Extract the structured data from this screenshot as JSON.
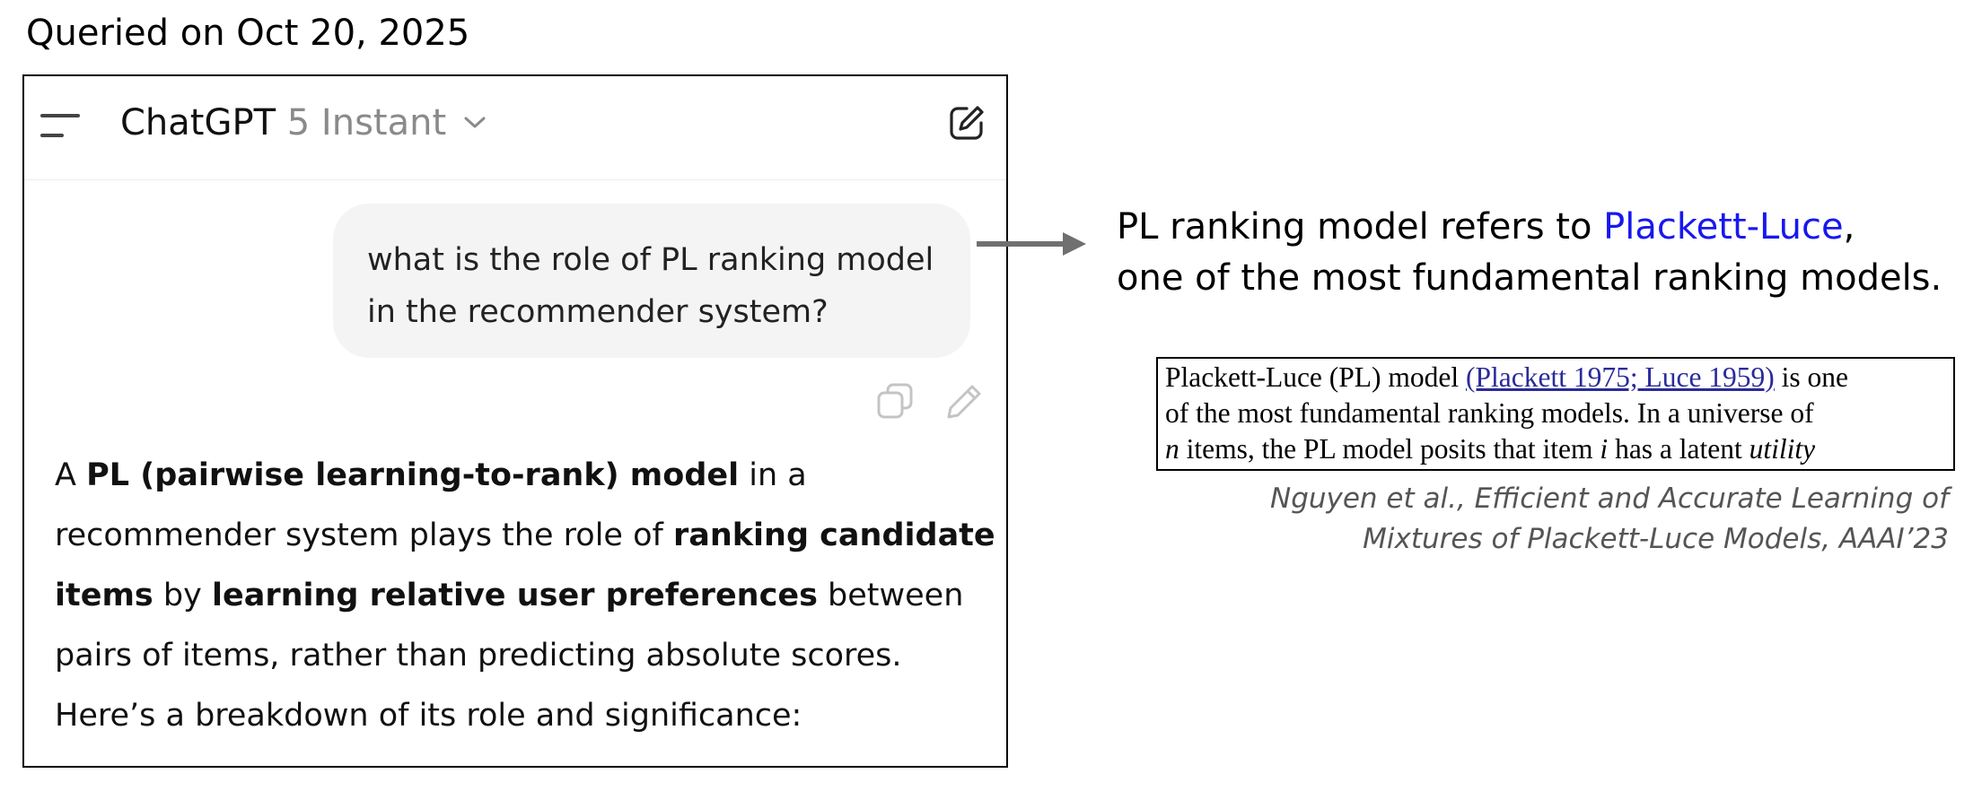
{
  "query_date": "Queried on Oct 20, 2025",
  "chat": {
    "header": {
      "menu_icon": "menu-icon",
      "app_name": "ChatGPT",
      "model_variant": "5 Instant",
      "chevron_icon": "chevron-down-icon",
      "new_chat_icon": "new-chat-icon"
    },
    "user_message": {
      "line1": "what is the role of PL ranking model",
      "line2": "in the recommender system?"
    },
    "message_actions": {
      "copy_icon": "copy-icon",
      "edit_icon": "edit-icon"
    },
    "assistant_message": {
      "a": "A ",
      "b1": "PL (pairwise learning-to-rank) model",
      "t1": " in a",
      "t2": "recommender system plays the role of ",
      "b2": "ranking candidate",
      "b3": "items",
      "t3": " by ",
      "b4": "learning relative user preferences",
      "t4": " between",
      "t5": "pairs of items, rather than predicting absolute scores.",
      "t6": "Here’s a breakdown of its role and significance:"
    }
  },
  "annotation": {
    "line1_prefix": "PL ranking model refers to ",
    "line1_link": "Plackett-Luce",
    "line1_suffix": ",",
    "line2": "one of the most fundamental ranking models.",
    "link_color": "#1818ee"
  },
  "paper_excerpt": {
    "l1_a": "Plackett-Luce (PL) model ",
    "l1_cite": "(Plackett 1975; Luce 1959)",
    "l1_b": " is one",
    "l2": "of the most fundamental ranking models. In a universe of",
    "l3_n": "n",
    "l3_a": " items, the PL model posits that item ",
    "l3_i": "i",
    "l3_b": " has a latent ",
    "l3_utility": "utility"
  },
  "caption": {
    "line1": "Nguyen et al., Efficient and Accurate Learning of",
    "line2": "Mixtures of Plackett-Luce Models, AAAI’23"
  }
}
